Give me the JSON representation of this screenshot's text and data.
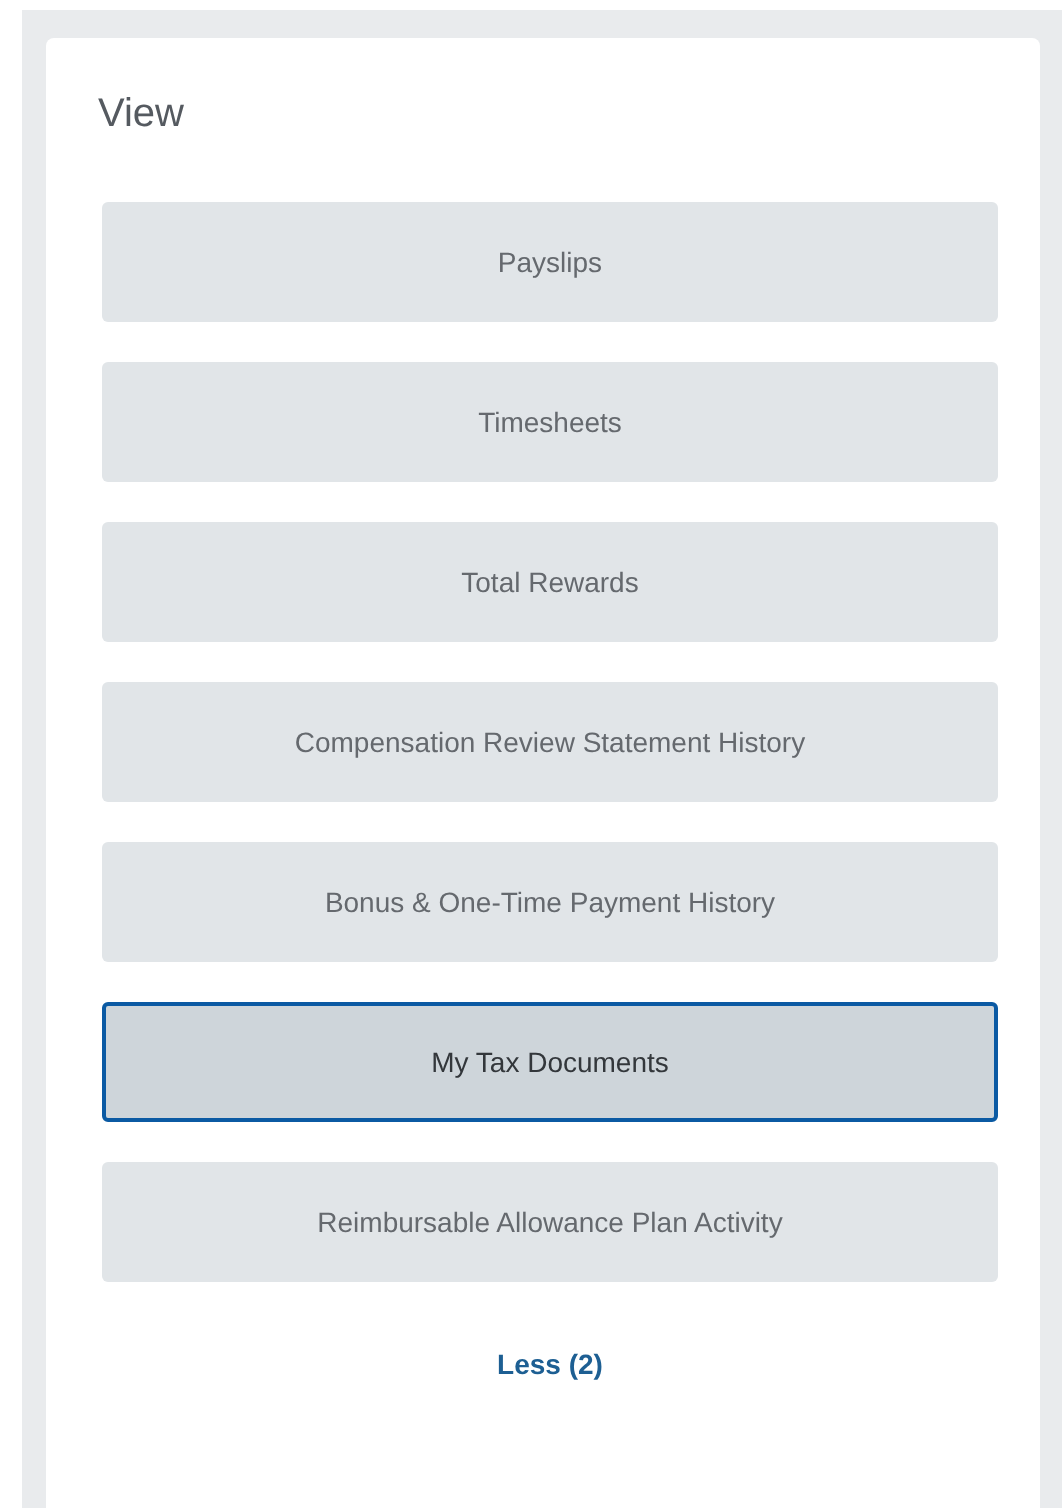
{
  "panel": {
    "title": "View",
    "buttons": [
      {
        "label": "Payslips",
        "selected": false
      },
      {
        "label": "Timesheets",
        "selected": false
      },
      {
        "label": "Total Rewards",
        "selected": false
      },
      {
        "label": "Compensation Review Statement History",
        "selected": false
      },
      {
        "label": "Bonus & One-Time Payment History",
        "selected": false
      },
      {
        "label": "My Tax Documents",
        "selected": true
      },
      {
        "label": "Reimbursable Allowance Plan Activity",
        "selected": false
      }
    ],
    "toggle_link": "Less (2)"
  }
}
